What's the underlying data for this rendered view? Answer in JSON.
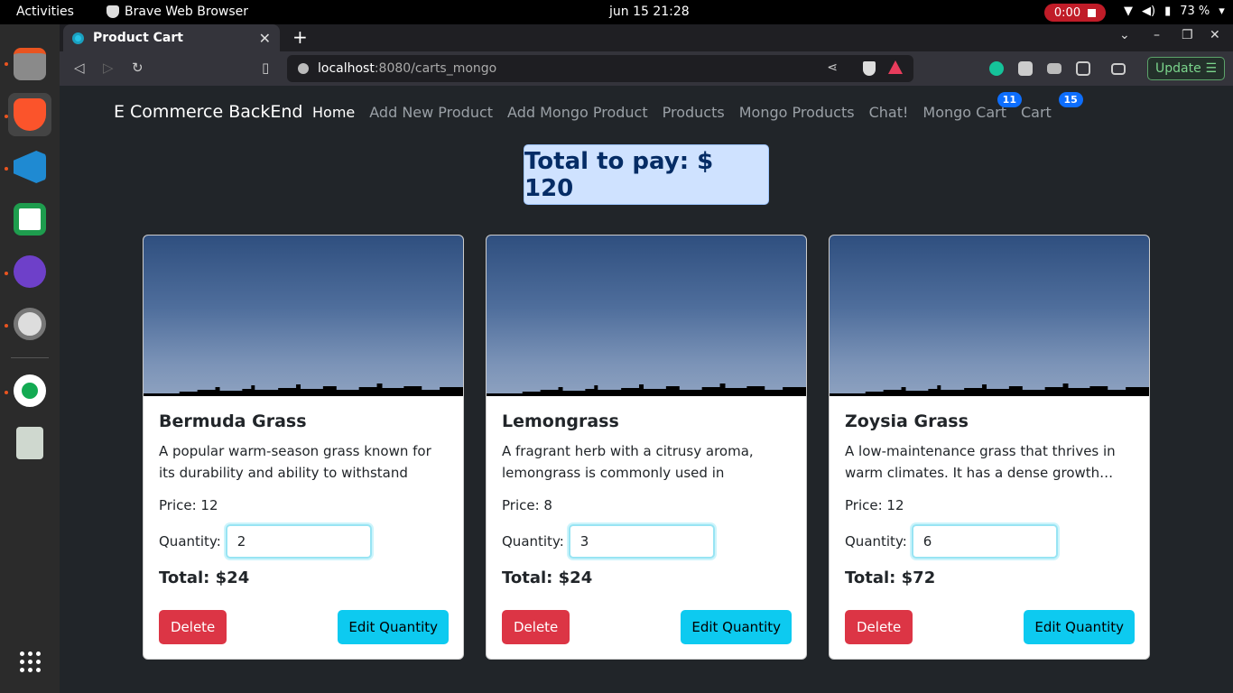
{
  "system": {
    "activities": "Activities",
    "app_name": "Brave Web Browser",
    "clock": "jun 15  21:28",
    "recording": "0:00",
    "battery": "73 %"
  },
  "browser": {
    "tab_title": "Product Cart",
    "url_host": "localhost",
    "url_path": ":8080/carts_mongo",
    "update_label": "Update"
  },
  "navbar": {
    "brand": "E Commerce BackEnd",
    "links": [
      "Home",
      "Add New Product",
      "Add Mongo Product",
      "Products",
      "Mongo Products",
      "Chat!",
      "Mongo Cart",
      "Cart"
    ],
    "mongo_cart_badge": "11",
    "cart_badge": "15"
  },
  "summary": {
    "total_label": "Total to pay: $ 120"
  },
  "cards": [
    {
      "name": "Bermuda Grass",
      "description": "A popular warm-season grass known for its durability and ability to withstand heavy…",
      "price": "Price: 12",
      "quantity_label": "Quantity:",
      "quantity": "2",
      "total": "Total: $24",
      "delete_label": "Delete",
      "edit_label": "Edit Quantity"
    },
    {
      "name": "Lemongrass",
      "description": "A fragrant herb with a citrusy aroma, lemongrass is commonly used in cooking…",
      "price": "Price: 8",
      "quantity_label": "Quantity:",
      "quantity": "3",
      "total": "Total: $24",
      "delete_label": "Delete",
      "edit_label": "Edit Quantity"
    },
    {
      "name": "Zoysia Grass",
      "description": "A low-maintenance grass that thrives in warm climates. It has a dense growth…",
      "price": "Price: 12",
      "quantity_label": "Quantity:",
      "quantity": "6",
      "total": "Total: $72",
      "delete_label": "Delete",
      "edit_label": "Edit Quantity"
    }
  ],
  "colors": {
    "danger": "#dc3545",
    "info": "#0dcaf0",
    "primary_badge": "#0d6efd",
    "alert_bg": "#cfe2ff"
  }
}
